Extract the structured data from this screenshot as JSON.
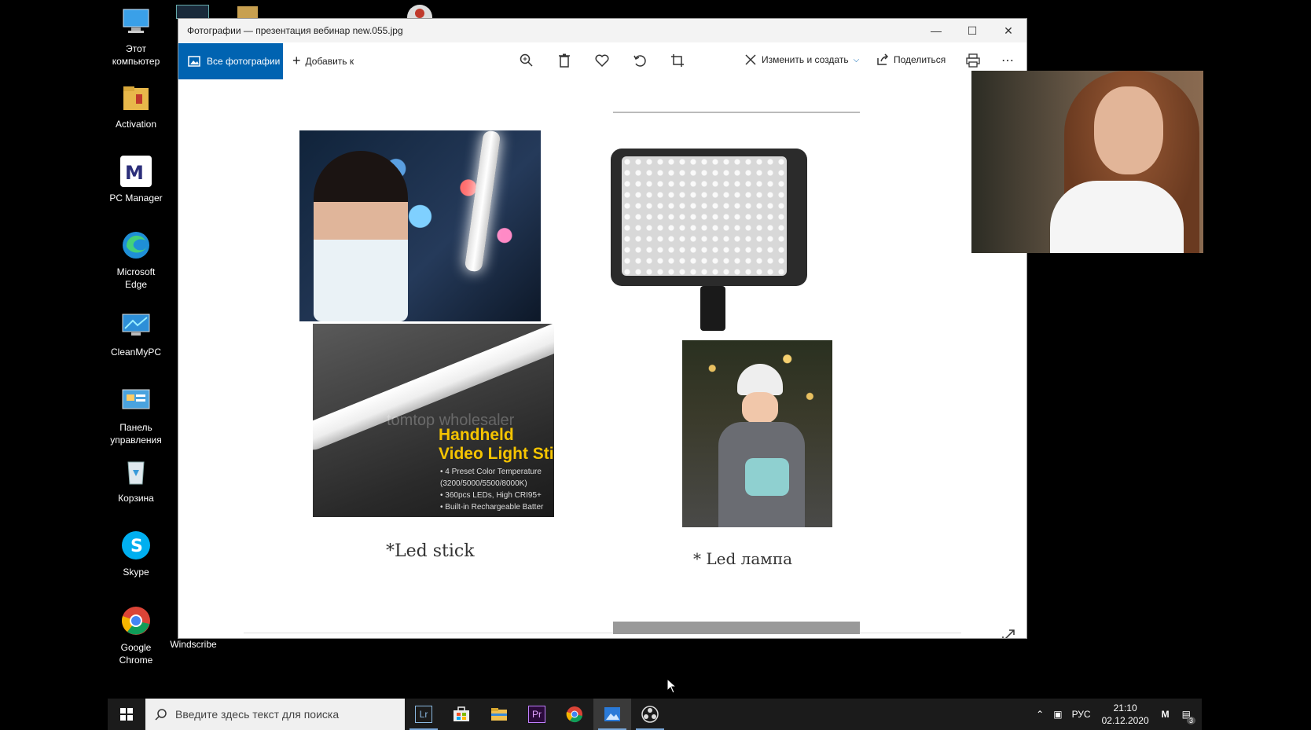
{
  "desktop": {
    "icons": [
      {
        "label_1": "Этот",
        "label_2": "компьютер",
        "icon": "computer-icon"
      },
      {
        "label_1": "Activation",
        "label_2": "",
        "icon": "folder-icon"
      },
      {
        "label_1": "PC Manager",
        "label_2": "",
        "icon": "pc-manager-icon"
      },
      {
        "label_1": "Microsoft",
        "label_2": "Edge",
        "icon": "edge-icon"
      },
      {
        "label_1": "CleanMyPC",
        "label_2": "",
        "icon": "cleanmypc-icon"
      },
      {
        "label_1": "Панель",
        "label_2": "управления",
        "icon": "control-panel-icon"
      },
      {
        "label_1": "Корзина",
        "label_2": "",
        "icon": "recycle-bin-icon"
      },
      {
        "label_1": "Skype",
        "label_2": "",
        "icon": "skype-icon"
      },
      {
        "label_1": "Google",
        "label_2": "Chrome",
        "icon": "chrome-icon"
      }
    ],
    "second_column": {
      "windscribe": "Windscribe"
    }
  },
  "window": {
    "title": "Фотографии — презентация вебинар new.055.jpg",
    "toolbar": {
      "all_photos": "Все фотографии",
      "add_to": "Добавить к",
      "edit_create": "Изменить и создать",
      "share": "Поделиться"
    }
  },
  "slide": {
    "caption_left": "*Led stick",
    "caption_right": "* Led лампа",
    "product_title_1": "Handheld",
    "product_title_2": "Video Light Stic",
    "watermark": "tomtop wholesaler",
    "bullets": [
      "• 4 Preset Color Temperature",
      "(3200/5000/5500/8000K)",
      "• 360pcs LEDs, High CRI95+",
      "• Built-in Rechargeable Batter"
    ]
  },
  "taskbar": {
    "search_placeholder": "Введите здесь текст для поиска",
    "lang": "РУС",
    "time": "21:10",
    "date": "02.12.2020",
    "notifications": "3"
  },
  "colors": {
    "accent": "#0063b1",
    "taskbar": "#1b1b1b"
  }
}
